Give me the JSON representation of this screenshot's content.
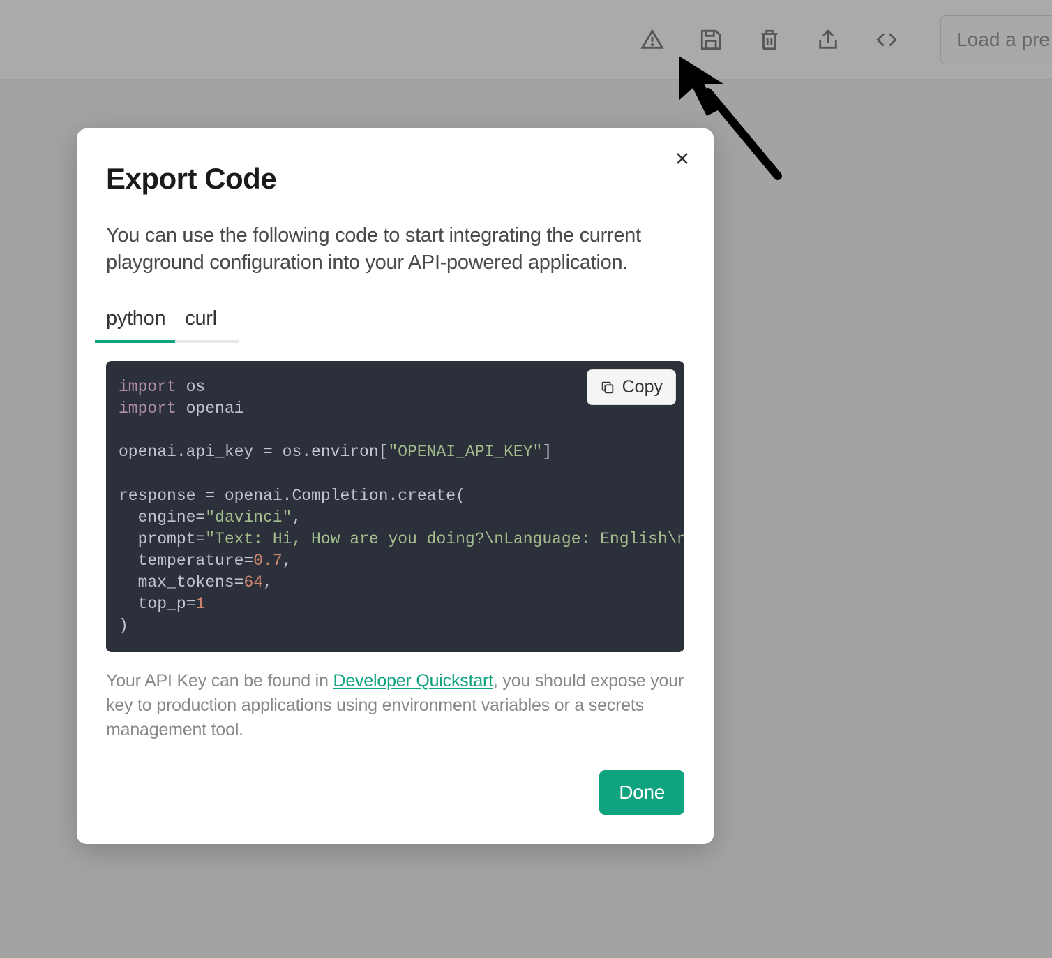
{
  "toolbar": {
    "preset_label": "Load a pre"
  },
  "modal": {
    "title": "Export Code",
    "description": "You can use the following code to start integrating the current playground configuration into your API-powered application.",
    "tabs": [
      {
        "label": "python",
        "active": true
      },
      {
        "label": "curl",
        "active": false
      }
    ],
    "copy_label": "Copy",
    "code": {
      "line1_kw": "import",
      "line1_nm": " os",
      "line2_kw": "import",
      "line2_nm": " openai",
      "line3_a": "openai.api_key = os.environ[",
      "line3_str": "\"OPENAI_API_KEY\"",
      "line3_b": "]",
      "line4": "response = openai.Completion.create(",
      "line5_a": "  engine=",
      "line5_str": "\"davinci\"",
      "line5_b": ",",
      "line6_a": "  prompt=",
      "line6_str": "\"Text: Hi, How are you doing?\\nLanguage: English\\n\\nText: Hall",
      "line7_a": "  temperature=",
      "line7_num": "0.7",
      "line7_b": ",",
      "line8_a": "  max_tokens=",
      "line8_num": "64",
      "line8_b": ",",
      "line9_a": "  top_p=",
      "line9_num": "1",
      "line10": ")"
    },
    "footer_pre": "Your API Key can be found in ",
    "footer_link": "Developer Quickstart",
    "footer_post": ", you should expose your key to production applications using environment variables or a secrets management tool.",
    "done_label": "Done"
  }
}
